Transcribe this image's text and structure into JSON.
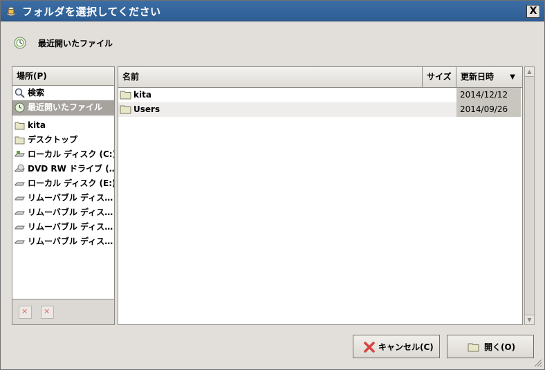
{
  "window": {
    "title": "フォルダを選択してください",
    "close_label": "X"
  },
  "location": {
    "label": "最近開いたファイル"
  },
  "places": {
    "header": "場所(P)",
    "items": [
      {
        "label": "検索",
        "icon": "search-icon"
      },
      {
        "label": "最近開いたファイル",
        "icon": "recent-icon",
        "selected": true
      }
    ],
    "bookmarks": [
      {
        "label": "kita",
        "icon": "folder-icon"
      },
      {
        "label": "デスクトップ",
        "icon": "folder-icon"
      },
      {
        "label": "ローカル ディスク (C:)",
        "icon": "drive-icon"
      },
      {
        "label": "DVD RW ドライブ (…",
        "icon": "dvd-drive-icon"
      },
      {
        "label": "ローカル ディスク (E:)",
        "icon": "drive-icon"
      },
      {
        "label": "リムーバブル ディス…",
        "icon": "removable-drive-icon"
      },
      {
        "label": "リムーバブル ディス…",
        "icon": "removable-drive-icon"
      },
      {
        "label": "リムーバブル ディス…",
        "icon": "removable-drive-icon"
      },
      {
        "label": "リムーバブル ディス…",
        "icon": "removable-drive-icon"
      }
    ]
  },
  "files": {
    "columns": {
      "name": "名前",
      "size": "サイズ",
      "modified": "更新日時"
    },
    "rows": [
      {
        "name": "kita",
        "modified": "2014/12/12",
        "icon": "folder-icon"
      },
      {
        "name": "Users",
        "modified": "2014/09/26",
        "icon": "folder-icon"
      }
    ]
  },
  "buttons": {
    "cancel": "キャンセル(C)",
    "open": "開く(O)"
  },
  "colors": {
    "titlebar": "#3b6ea5",
    "selected": "#a6a39e",
    "sorted_column": "#c9c6c0"
  }
}
